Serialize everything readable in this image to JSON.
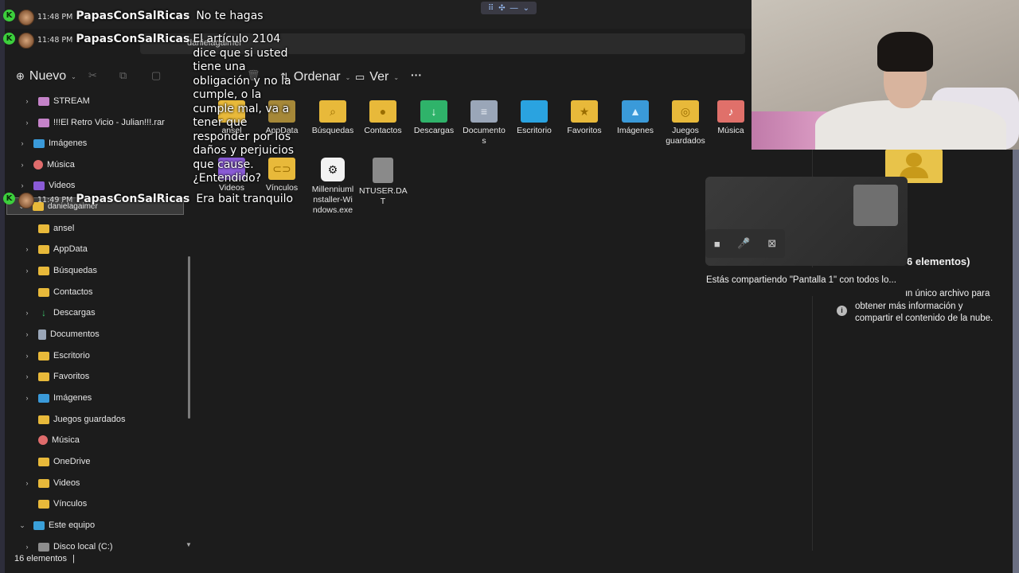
{
  "explorer": {
    "address_folder": "danielagaimer",
    "address_chevron": "›",
    "toolbar": {
      "new_label": "Nuevo",
      "sort_label": "Ordenar",
      "view_label": "Ver",
      "more_label": "···"
    },
    "sidebar": {
      "items": [
        {
          "label": "STREAM",
          "icon": "rar-icon",
          "expandable": true
        },
        {
          "label": "!!!El Retro Vicio - Julian!!!.rar",
          "icon": "rar-icon",
          "expandable": true
        },
        {
          "label": "Imágenes",
          "icon": "images-icon",
          "expandable": true
        },
        {
          "label": "Música",
          "icon": "music-icon",
          "expandable": true
        },
        {
          "label": "Videos",
          "icon": "video-icon",
          "expandable": true
        },
        {
          "label": "danielagaimer",
          "icon": "user-folder-icon",
          "expandable": true,
          "selected": true
        },
        {
          "label": "ansel",
          "icon": "folder-icon",
          "expandable": false
        },
        {
          "label": "AppData",
          "icon": "folder-icon",
          "expandable": true
        },
        {
          "label": "Búsquedas",
          "icon": "folder-icon",
          "expandable": true
        },
        {
          "label": "Contactos",
          "icon": "folder-icon",
          "expandable": false
        },
        {
          "label": "Descargas",
          "icon": "download-icon",
          "expandable": true
        },
        {
          "label": "Documentos",
          "icon": "document-icon",
          "expandable": true
        },
        {
          "label": "Escritorio",
          "icon": "folder-icon",
          "expandable": true
        },
        {
          "label": "Favoritos",
          "icon": "folder-icon",
          "expandable": true
        },
        {
          "label": "Imágenes",
          "icon": "images-icon",
          "expandable": true
        },
        {
          "label": "Juegos guardados",
          "icon": "folder-icon",
          "expandable": false
        },
        {
          "label": "Música",
          "icon": "music-icon",
          "expandable": false
        },
        {
          "label": "OneDrive",
          "icon": "folder-icon",
          "expandable": false
        },
        {
          "label": "Videos",
          "icon": "video-icon",
          "expandable": true
        },
        {
          "label": "Vínculos",
          "icon": "folder-icon",
          "expandable": false
        },
        {
          "label": "Este equipo",
          "icon": "pc-icon",
          "expandable": true,
          "expanded": true
        },
        {
          "label": "Disco local (C:)",
          "icon": "drive-icon",
          "expandable": true
        }
      ]
    },
    "grid": {
      "row1": [
        {
          "label": "ansel",
          "icon": "folder-icon"
        },
        {
          "label": "AppData",
          "icon": "folder-icon"
        },
        {
          "label": "Búsquedas",
          "icon": "search-folder-icon"
        },
        {
          "label": "Contactos",
          "icon": "contacts-folder-icon"
        },
        {
          "label": "Descargas",
          "icon": "downloads-folder-icon"
        },
        {
          "label": "Documento\ns",
          "icon": "documents-folder-icon"
        },
        {
          "label": "Escritorio",
          "icon": "desktop-folder-icon"
        },
        {
          "label": "Favoritos",
          "icon": "favorites-folder-icon"
        },
        {
          "label": "Imágenes",
          "icon": "pictures-folder-icon"
        },
        {
          "label": "Juegos\nguardados",
          "icon": "games-folder-icon"
        },
        {
          "label": "Música",
          "icon": "music-folder-icon"
        }
      ],
      "row2": [
        {
          "label": "Videos",
          "icon": "videos-folder-icon"
        },
        {
          "label": "Vínculos",
          "icon": "links-folder-icon"
        },
        {
          "label": "Millenniuml\nnstaller-Wi\nndows.exe",
          "icon": "steam-icon"
        },
        {
          "label": "NTUSER.DA\nT",
          "icon": "file-icon"
        }
      ]
    },
    "status": {
      "count": "16 elementos",
      "separator": "|"
    },
    "details": {
      "title": "6 elementos)",
      "text": "Selecciona un único archivo para obtener más información y compartir el contenido de la nube."
    }
  },
  "screen_share": {
    "text": "Estás compartiendo \"Pantalla 1\" con todos lo..."
  },
  "chat": [
    {
      "time": "11:48 PM",
      "user": "PapasConSalRicas",
      "message": "No te hagas"
    },
    {
      "time": "11:48 PM",
      "user": "PapasConSalRicas",
      "message": "El artículo 2104 dice que si usted tiene una obligación y no la cumple, o la cumple mal, va a tener que responder por los daños y perjuicios que cause. ¿Entendido?"
    },
    {
      "time": "11:49 PM",
      "user": "PapasConSalRicas",
      "message": "Era bait tranquilo"
    }
  ],
  "colors": {
    "folder_yellow": "#e8b93a",
    "window_bg": "#1c1c1c",
    "chat_badge_green": "#3ccf3c"
  }
}
